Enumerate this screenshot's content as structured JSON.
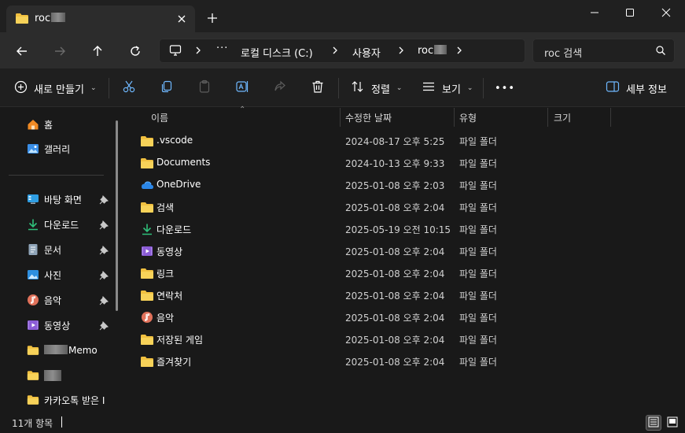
{
  "titlebar": {
    "tab_title": "roc",
    "new_tab": "+"
  },
  "address": {
    "crumbs": [
      "로컬 디스크 (C:)",
      "사용자",
      "roc"
    ],
    "more": "···"
  },
  "search": {
    "placeholder": "roc 검색"
  },
  "commands": {
    "new": "새로 만들기",
    "sort": "정렬",
    "view": "보기",
    "more": "•••",
    "details": "세부 정보"
  },
  "sidebar": {
    "top": [
      {
        "label": "홈",
        "icon": "home-icon"
      },
      {
        "label": "갤러리",
        "icon": "gallery-icon"
      }
    ],
    "pinned": [
      {
        "label": "바탕 화면",
        "icon": "desktop-icon"
      },
      {
        "label": "다운로드",
        "icon": "download-icon"
      },
      {
        "label": "문서",
        "icon": "document-icon"
      },
      {
        "label": "사진",
        "icon": "pictures-icon"
      },
      {
        "label": "음악",
        "icon": "music-icon"
      },
      {
        "label": "동영상",
        "icon": "video-icon"
      }
    ],
    "folders": [
      {
        "label": "Memo",
        "icon": "folder-icon"
      },
      {
        "label": "",
        "icon": "folder-icon"
      },
      {
        "label": "카카오톡 받은 I",
        "icon": "folder-icon"
      }
    ]
  },
  "columns": {
    "name": "이름",
    "modified": "수정한 날짜",
    "type": "유형",
    "size": "크기"
  },
  "files": [
    {
      "name": ".vscode",
      "modified": "2024-08-17 오후 5:25",
      "type": "파일 폴더",
      "icon": "folder-icon"
    },
    {
      "name": "Documents",
      "modified": "2024-10-13 오후 9:33",
      "type": "파일 폴더",
      "icon": "folder-icon"
    },
    {
      "name": "OneDrive",
      "modified": "2025-01-08 오후 2:03",
      "type": "파일 폴더",
      "icon": "onedrive-icon"
    },
    {
      "name": "검색",
      "modified": "2025-01-08 오후 2:04",
      "type": "파일 폴더",
      "icon": "folder-icon"
    },
    {
      "name": "다운로드",
      "modified": "2025-05-19 오전 10:15",
      "type": "파일 폴더",
      "icon": "download-icon"
    },
    {
      "name": "동영상",
      "modified": "2025-01-08 오후 2:04",
      "type": "파일 폴더",
      "icon": "video-icon"
    },
    {
      "name": "링크",
      "modified": "2025-01-08 오후 2:04",
      "type": "파일 폴더",
      "icon": "folder-icon"
    },
    {
      "name": "연락처",
      "modified": "2025-01-08 오후 2:04",
      "type": "파일 폴더",
      "icon": "folder-icon"
    },
    {
      "name": "음악",
      "modified": "2025-01-08 오후 2:04",
      "type": "파일 폴더",
      "icon": "music-icon"
    },
    {
      "name": "저장된 게임",
      "modified": "2025-01-08 오후 2:04",
      "type": "파일 폴더",
      "icon": "folder-icon"
    },
    {
      "name": "즐겨찾기",
      "modified": "2025-01-08 오후 2:04",
      "type": "파일 폴더",
      "icon": "folder-icon"
    }
  ],
  "status": {
    "count": "11개 항목"
  },
  "colors": {
    "folder": "#f0c040",
    "accent": "#3d8fe0",
    "background": "#191919"
  }
}
